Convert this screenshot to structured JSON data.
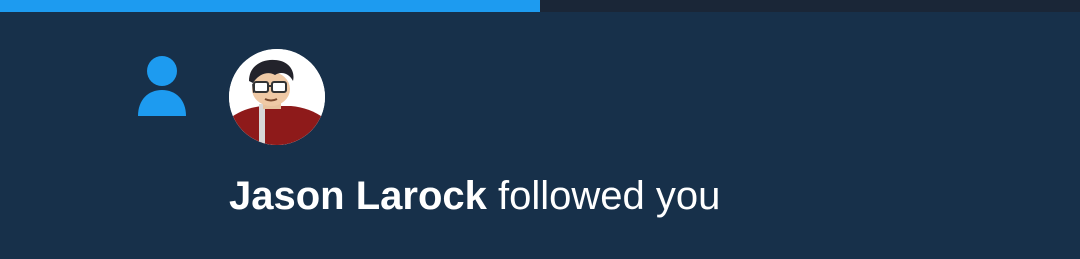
{
  "progress": {
    "fraction": 0.5,
    "fill_color": "#1d9bf0"
  },
  "notification": {
    "type_icon": "person-icon",
    "accent_color": "#1d9bf0",
    "user_name": "Jason Larock",
    "action_text": " followed you"
  }
}
